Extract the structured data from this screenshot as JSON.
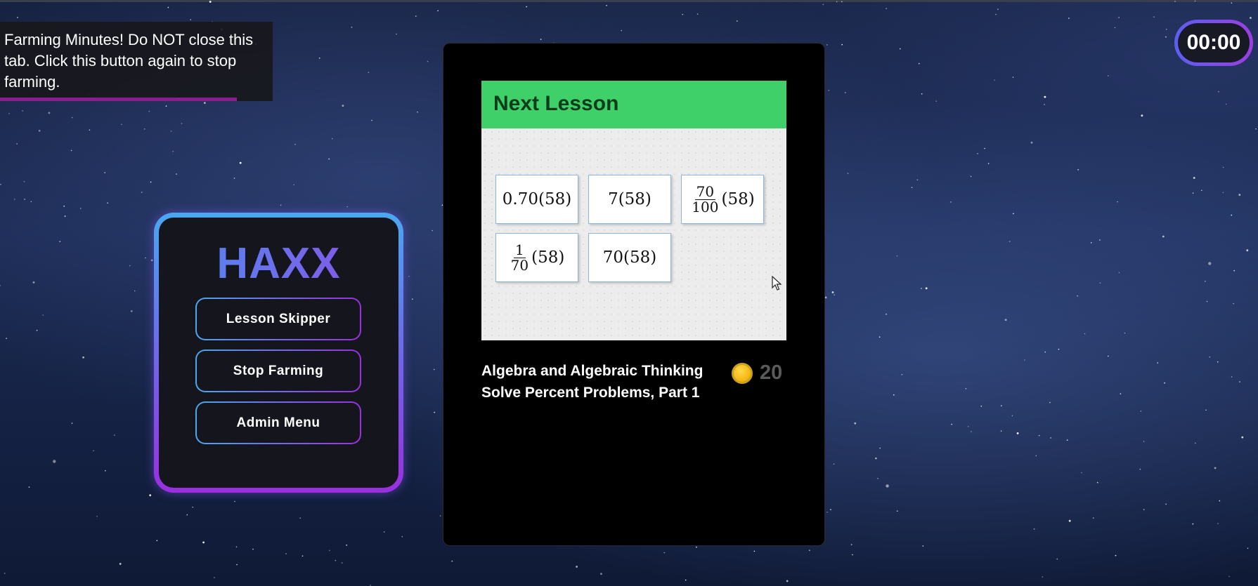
{
  "toast": {
    "message": "Farming Minutes! Do NOT close this tab. Click this button again to stop farming."
  },
  "timer": {
    "value": "00:00"
  },
  "panel": {
    "title": "HAXX",
    "buttons": [
      "Lesson Skipper",
      "Stop Farming",
      "Admin Menu"
    ]
  },
  "lesson_card": {
    "header": "Next Lesson",
    "options": {
      "o1": "0.70(58)",
      "o2": "7(58)",
      "o3": {
        "numerator": "70",
        "denominator": "100",
        "rest": "(58)"
      },
      "o4": {
        "numerator": "1",
        "denominator": "70",
        "rest": "(58)"
      },
      "o5": "70(58)"
    },
    "course": "Algebra and Algebraic Thinking",
    "lesson": "Solve Percent Problems, Part 1",
    "coin_icon": "coin-icon",
    "points": "20"
  },
  "colors": {
    "header_green": "#3fd06a",
    "panel_gradient_start": "#4aa8f0",
    "panel_gradient_end": "#9a2fe0",
    "toast_progress": "#8b1d8e"
  }
}
